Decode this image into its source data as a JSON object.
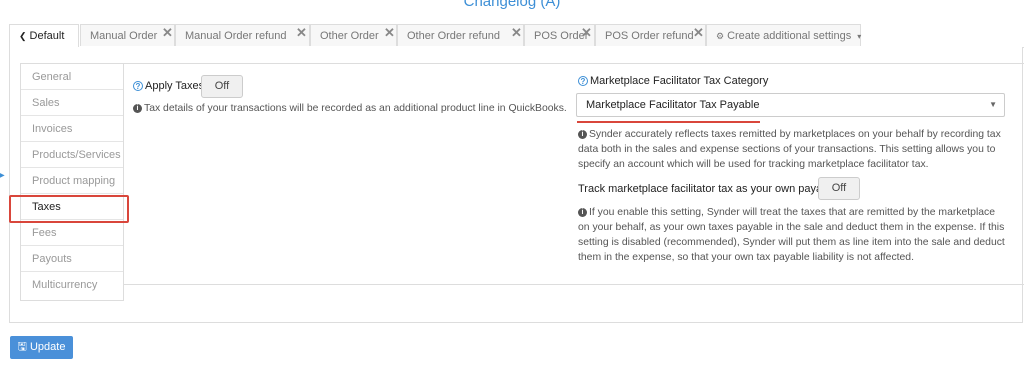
{
  "page_title": "Changelog (A)",
  "tabs": [
    {
      "label": "Default",
      "icon": "home-icon",
      "active": true
    },
    {
      "label": "Manual Order",
      "closable": true
    },
    {
      "label": "Manual Order refund",
      "closable": true
    },
    {
      "label": "Other Order",
      "closable": true
    },
    {
      "label": "Other Order refund",
      "closable": true
    },
    {
      "label": "POS Order",
      "closable": true
    },
    {
      "label": "POS Order refund",
      "closable": true
    },
    {
      "label": "Create additional settings",
      "icon": "gear-icon",
      "dropdown": true
    }
  ],
  "side_menu": [
    "General",
    "Sales",
    "Invoices",
    "Products/Services",
    "Product mapping",
    "Taxes",
    "Fees",
    "Payouts",
    "Multicurrency"
  ],
  "side_menu_active": "Taxes",
  "apply_taxes": {
    "label": "Apply Taxes",
    "toggle": "Off",
    "note": "Tax details of your transactions will be recorded as an additional product line in QuickBooks."
  },
  "marketplace": {
    "label": "Marketplace Facilitator Tax Category",
    "select_value": "Marketplace Facilitator Tax Payable",
    "note": "Synder accurately reflects taxes remitted by marketplaces on your behalf by recording tax data both in the sales and expense sections of your transactions. This setting allows you to specify an account which will be used for tracking marketplace facilitator tax.",
    "track_label": "Track marketplace facilitator tax as your own payable",
    "track_toggle": "Off",
    "track_note": "If you enable this setting, Synder will treat the taxes that are remitted by the marketplace on your behalf, as your own taxes payable in the sale and deduct them in the expense. If this setting is disabled (recommended), Synder will put them as line item into the sale and deduct them in the expense, so that your own tax payable liability is not affected."
  },
  "update_button": "Update",
  "icons": {
    "close": "close-icon",
    "update": "save-icon",
    "help": "help-icon",
    "info": "info-icon"
  },
  "colors": {
    "accent": "#3d8fd6",
    "highlight": "#d9463b",
    "button": "#4a90d9"
  }
}
